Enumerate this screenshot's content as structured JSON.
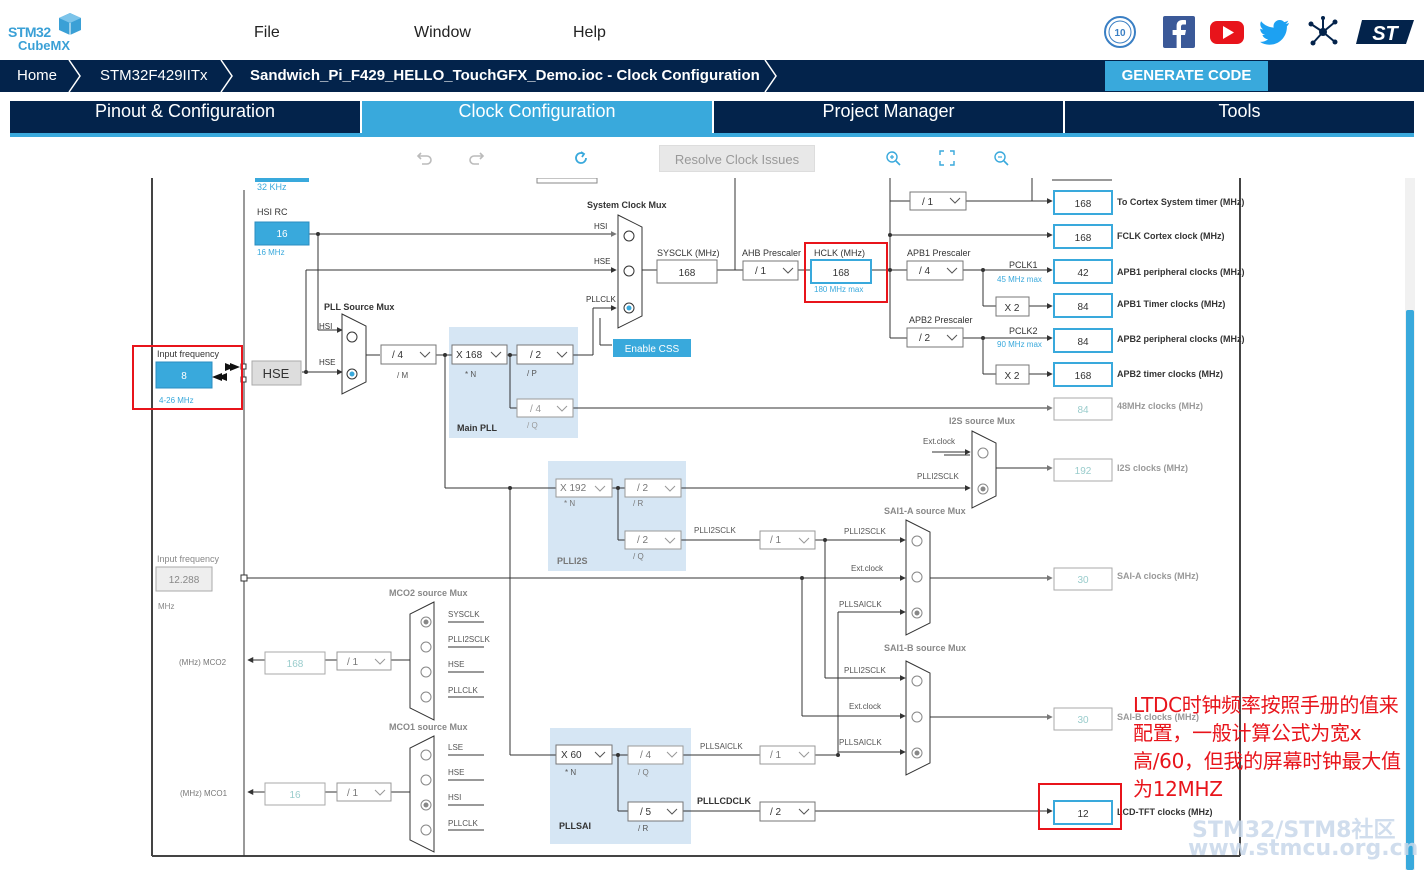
{
  "app": {
    "logo_line1": "STM32",
    "logo_line2": "CubeMX"
  },
  "menu": {
    "file": "File",
    "window": "Window",
    "help": "Help"
  },
  "breadcrumb": {
    "home": "Home",
    "mcu": "STM32F429IITx",
    "project": "Sandwich_Pi_F429_HELLO_TouchGFX_Demo.ioc - Clock Configuration"
  },
  "toolbar": {
    "generate_code": "GENERATE CODE",
    "resolve": "Resolve Clock Issues"
  },
  "tabs": [
    {
      "label": "Pinout & Configuration"
    },
    {
      "label": "Clock Configuration",
      "active": true
    },
    {
      "label": "Project Manager"
    },
    {
      "label": "Tools"
    }
  ],
  "colors": {
    "navy": "#03234b",
    "accent": "#39a9dc",
    "highlight": "#e8141b"
  },
  "clock": {
    "lse": {
      "freq_label": "32 KHz"
    },
    "hsi": {
      "title": "HSI RC",
      "value": "16",
      "freq_label": "16 MHz"
    },
    "input": {
      "title": "Input frequency",
      "value": "8",
      "range": "4-26 MHz"
    },
    "hse_label": "HSE",
    "pll_source_mux": {
      "title": "PLL Source Mux",
      "hsi": "HSI",
      "hse": "HSE"
    },
    "pllm": {
      "value": "/ 4",
      "label": "/ M"
    },
    "plln": {
      "value": "X 168",
      "label": "* N"
    },
    "pllp": {
      "value": "/ 2",
      "label": "/ P"
    },
    "pllq": {
      "value": "/ 4",
      "label": "/ Q"
    },
    "main_pll": "Main PLL",
    "sys_mux": {
      "title": "System Clock Mux",
      "hsi": "HSI",
      "hse": "HSE",
      "pllclk": "PLLCLK"
    },
    "enable_css": "Enable CSS",
    "sysclk": {
      "title": "SYSCLK (MHz)",
      "value": "168"
    },
    "ahb": {
      "title": "AHB Prescaler",
      "value": "/ 1"
    },
    "hclk": {
      "title": "HCLK (MHz)",
      "value": "168",
      "max": "180 MHz max"
    },
    "cortex_div": "/ 1",
    "apb1": {
      "title": "APB1 Prescaler",
      "value": "/ 4",
      "pclk": "PCLK1",
      "max": "45 MHz max",
      "x": "X 2"
    },
    "apb2": {
      "title": "APB2 Prescaler",
      "value": "/ 2",
      "pclk": "PCLK2",
      "max": "90 MHz max",
      "x": "X 2"
    },
    "outputs": [
      {
        "value": "168",
        "label": "To Cortex System timer (MHz)"
      },
      {
        "value": "168",
        "label": "FCLK Cortex clock (MHz)"
      },
      {
        "value": "42",
        "label": "APB1 peripheral clocks (MHz)"
      },
      {
        "value": "84",
        "label": "APB1 Timer clocks (MHz)"
      },
      {
        "value": "84",
        "label": "APB2 peripheral clocks (MHz)"
      },
      {
        "value": "168",
        "label": "APB2 timer clocks (MHz)"
      },
      {
        "value": "84",
        "label": "48MHz clocks (MHz)"
      }
    ],
    "i2s_mux": {
      "title": "I2S source Mux",
      "ext": "Ext.clock",
      "plli2sclk": "PLLI2SCLK"
    },
    "i2s_out": {
      "value": "192",
      "label": "I2S clocks (MHz)"
    },
    "plli2s": {
      "n": "X 192",
      "n_label": "* N",
      "r": "/ 2",
      "r_label": "/ R",
      "q": "/ 2",
      "q_label": "/ Q",
      "title": "PLLI2S",
      "clk": "PLLI2SCLK",
      "div": "/ 1"
    },
    "ext_input": {
      "title": "Input frequency",
      "value": "12.288",
      "unit": "MHz"
    },
    "saia_mux": {
      "title": "SAI1-A source Mux",
      "plli2sclk": "PLLI2SCLK",
      "ext": "Ext.clock",
      "pllsaiclk": "PLLSAICLK"
    },
    "saia_out": {
      "value": "30",
      "label": "SAI-A clocks (MHz)"
    },
    "saib_mux": {
      "title": "SAI1-B source Mux",
      "plli2sclk": "PLLI2SCLK",
      "ext": "Ext.clock",
      "pllsaiclk": "PLLSAICLK"
    },
    "saib_out": {
      "value": "30",
      "label": "SAI-B clocks (MHz)"
    },
    "mco2": {
      "title": "MCO2 source Mux",
      "sysclk": "SYSCLK",
      "plli2sclk": "PLLI2SCLK",
      "hse": "HSE",
      "pllclk": "PLLCLK",
      "div": "/ 1",
      "value": "168",
      "label": "(MHz) MCO2"
    },
    "mco1": {
      "title": "MCO1 source Mux",
      "lse": "LSE",
      "hse": "HSE",
      "hsi": "HSI",
      "pllclk": "PLLCLK",
      "div": "/ 1",
      "value": "16",
      "label": "(MHz) MCO1"
    },
    "pllsai": {
      "n": "X 60",
      "n_label": "* N",
      "q": "/ 4",
      "q_label": "/ Q",
      "r": "/ 5",
      "r_label": "/ R",
      "title": "PLLSAI",
      "clk": "PLLSAICLK",
      "lcdclk": "PLLLCDCLK",
      "lcd_div": "/ 2",
      "div": "/ 1"
    },
    "lcd_out": {
      "value": "12",
      "label": "LCD-TFT clocks (MHz)"
    }
  },
  "annotation": "LTDC时钟频率按照手册的值来配置，一般计算公式为宽x高/60，但我的屏幕时钟最大值为12MHZ",
  "watermark": {
    "line1": "STM32/STM8社区",
    "line2": "www.stmcu.org.cn"
  }
}
